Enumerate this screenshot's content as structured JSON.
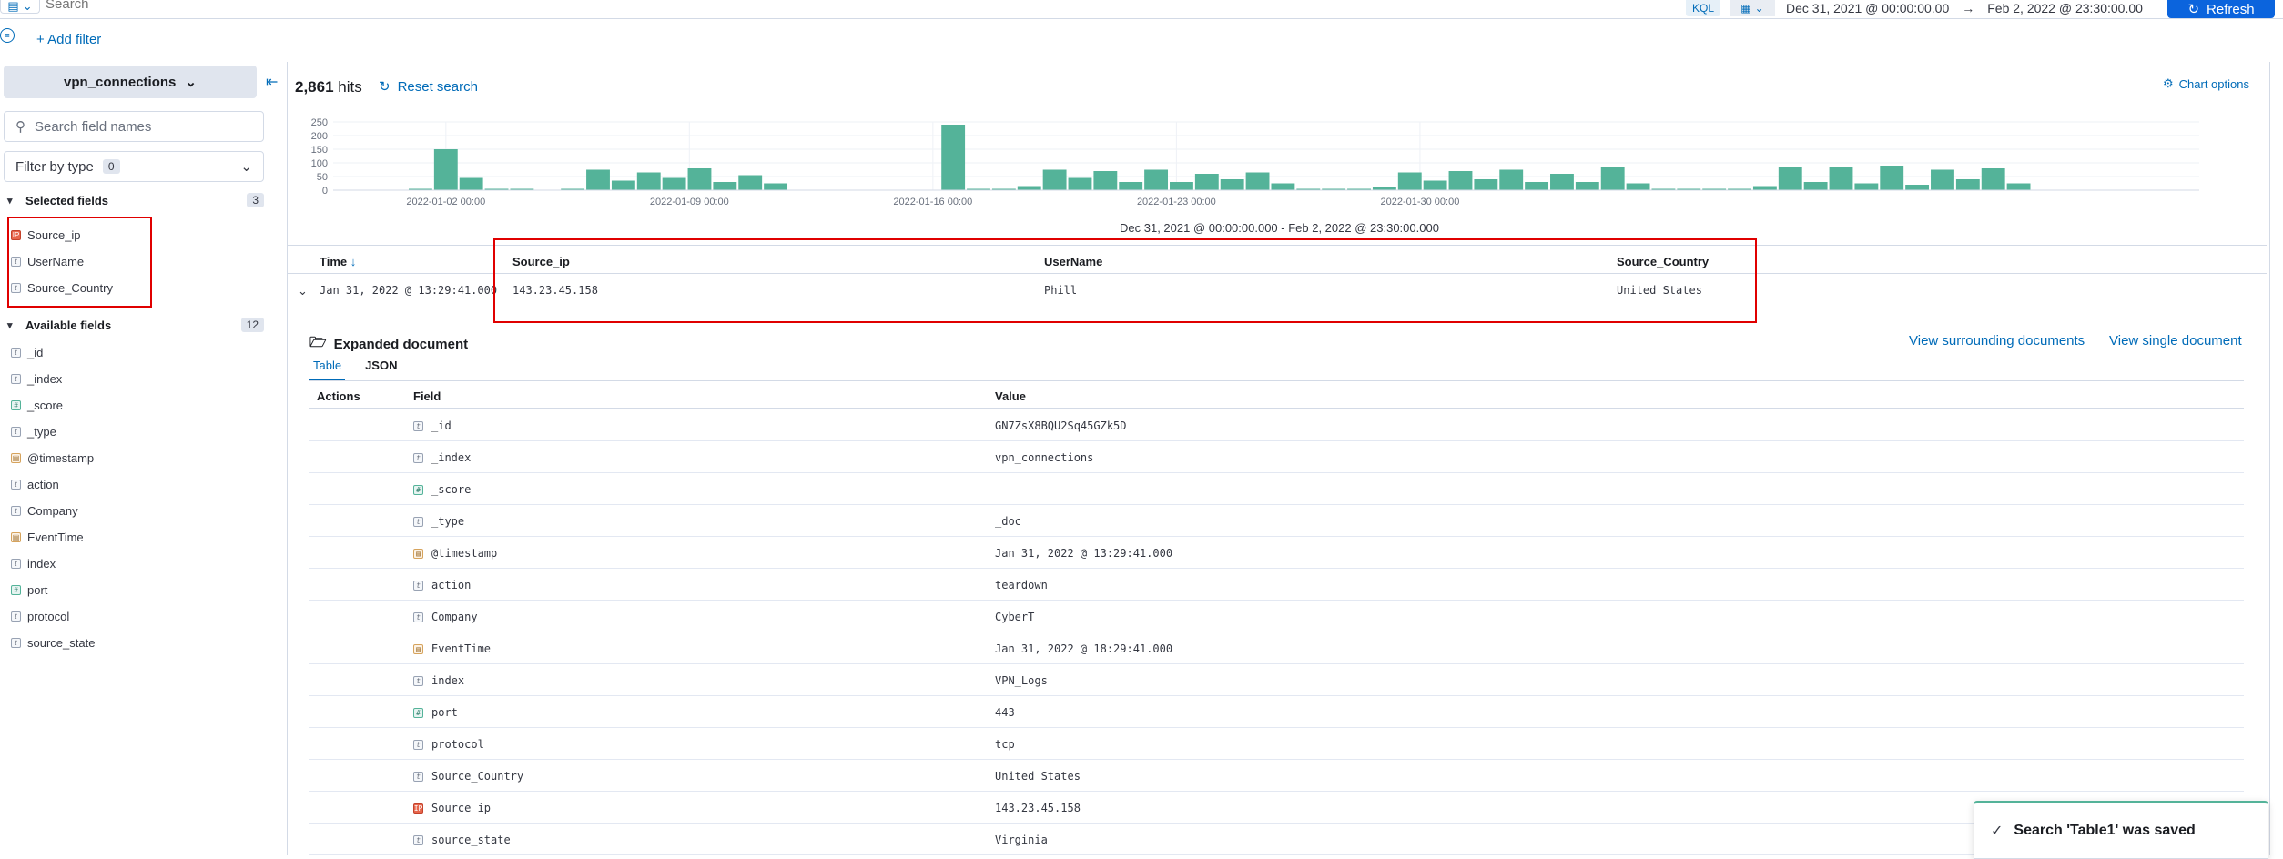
{
  "search": {
    "placeholder": "Search",
    "kql": "KQL"
  },
  "timerange": {
    "start": "Dec 31, 2021 @ 00:00:00.00",
    "arrow": "→",
    "end": "Feb 2, 2022 @ 23:30:00.00"
  },
  "refresh_label": "Refresh",
  "add_filter": "+ Add filter",
  "sidebar": {
    "index_pattern": "vpn_connections",
    "field_search_placeholder": "Search field names",
    "filter_by_type": "Filter by type",
    "filter_count": "0",
    "selected_header": "Selected fields",
    "selected_count": "3",
    "selected": [
      {
        "name": "Source_ip",
        "type": "ip",
        "glyph": "IP"
      },
      {
        "name": "UserName",
        "type": "string",
        "glyph": "t"
      },
      {
        "name": "Source_Country",
        "type": "string",
        "glyph": "t"
      }
    ],
    "available_header": "Available fields",
    "available_count": "12",
    "available": [
      {
        "name": "_id",
        "type": "string",
        "glyph": "t"
      },
      {
        "name": "_index",
        "type": "string",
        "glyph": "t"
      },
      {
        "name": "_score",
        "type": "number",
        "glyph": "#"
      },
      {
        "name": "_type",
        "type": "string",
        "glyph": "t"
      },
      {
        "name": "@timestamp",
        "type": "date",
        "glyph": "▤"
      },
      {
        "name": "action",
        "type": "string",
        "glyph": "t"
      },
      {
        "name": "Company",
        "type": "string",
        "glyph": "t"
      },
      {
        "name": "EventTime",
        "type": "date",
        "glyph": "▤"
      },
      {
        "name": "index",
        "type": "string",
        "glyph": "t"
      },
      {
        "name": "port",
        "type": "number",
        "glyph": "#"
      },
      {
        "name": "protocol",
        "type": "string",
        "glyph": "t"
      },
      {
        "name": "source_state",
        "type": "string",
        "glyph": "t"
      }
    ]
  },
  "hits": {
    "count": "2,861",
    "label": "hits"
  },
  "reset_search": "Reset search",
  "chart_options": "Chart options",
  "chart_data": {
    "type": "bar",
    "y_ticks": [
      "250",
      "200",
      "150",
      "100",
      "50",
      "0"
    ],
    "ylim": [
      0,
      250
    ],
    "x_ticks": [
      "2022-01-02 00:00",
      "2022-01-09 00:00",
      "2022-01-16 00:00",
      "2022-01-23 00:00",
      "2022-01-30 00:00"
    ],
    "values": [
      5,
      150,
      45,
      5,
      5,
      0,
      5,
      75,
      35,
      65,
      45,
      80,
      30,
      55,
      25,
      0,
      0,
      0,
      0,
      0,
      0,
      240,
      5,
      5,
      15,
      75,
      45,
      70,
      30,
      75,
      30,
      60,
      40,
      65,
      25,
      5,
      5,
      5,
      10,
      65,
      35,
      70,
      40,
      75,
      30,
      60,
      30,
      85,
      25,
      5,
      5,
      5,
      5,
      15,
      85,
      30,
      85,
      25,
      90,
      20,
      75,
      40,
      80,
      25
    ],
    "color": "#54b399",
    "range_label": "Dec 31, 2021 @ 00:00:00.000 - Feb 2, 2022 @ 23:30:00.000"
  },
  "table": {
    "columns": [
      "Time",
      "Source_ip",
      "UserName",
      "Source_Country"
    ],
    "sort_indicator": "↓",
    "row": {
      "time": "Jan 31, 2022 @ 13:29:41.000",
      "source_ip": "143.23.45.158",
      "username": "Phill",
      "country": "United States"
    }
  },
  "expanded": {
    "title": "Expanded document",
    "surrounding": "View surrounding documents",
    "single": "View single document",
    "tabs": [
      "Table",
      "JSON"
    ],
    "headers": [
      "Actions",
      "Field",
      "Value"
    ],
    "rows": [
      {
        "field": "_id",
        "glyph": "t",
        "type": "string",
        "value": "GN7ZsX8BQU2Sq45GZk5D"
      },
      {
        "field": "_index",
        "glyph": "t",
        "type": "string",
        "value": "vpn_connections"
      },
      {
        "field": "_score",
        "glyph": "#",
        "type": "number",
        "value": " -"
      },
      {
        "field": "_type",
        "glyph": "t",
        "type": "string",
        "value": "_doc"
      },
      {
        "field": "@timestamp",
        "glyph": "▤",
        "type": "date",
        "value": "Jan 31, 2022 @ 13:29:41.000"
      },
      {
        "field": "action",
        "glyph": "t",
        "type": "string",
        "value": "teardown"
      },
      {
        "field": "Company",
        "glyph": "t",
        "type": "string",
        "value": "CyberT"
      },
      {
        "field": "EventTime",
        "glyph": "▤",
        "type": "date",
        "value": "Jan 31, 2022 @ 18:29:41.000"
      },
      {
        "field": "index",
        "glyph": "t",
        "type": "string",
        "value": "VPN_Logs"
      },
      {
        "field": "port",
        "glyph": "#",
        "type": "number",
        "value": "443"
      },
      {
        "field": "protocol",
        "glyph": "t",
        "type": "string",
        "value": "tcp"
      },
      {
        "field": "Source_Country",
        "glyph": "t",
        "type": "string",
        "value": "United States"
      },
      {
        "field": "Source_ip",
        "glyph": "IP",
        "type": "ip",
        "value": "143.23.45.158"
      },
      {
        "field": "source_state",
        "glyph": "t",
        "type": "string",
        "value": "Virginia"
      }
    ]
  },
  "toast": "Search 'Table1' was saved"
}
